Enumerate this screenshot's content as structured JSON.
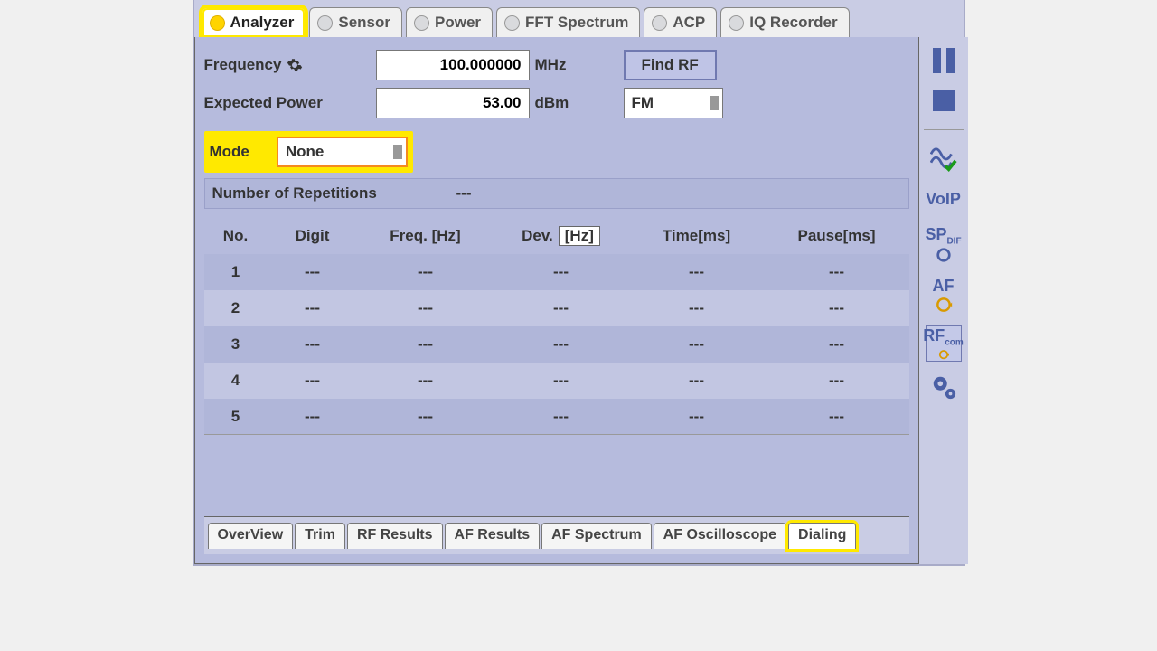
{
  "top_tabs": [
    {
      "label": "Analyzer"
    },
    {
      "label": "Sensor"
    },
    {
      "label": "Power"
    },
    {
      "label": "FFT Spectrum"
    },
    {
      "label": "ACP"
    },
    {
      "label": "IQ Recorder"
    }
  ],
  "params": {
    "freq_label": "Frequency",
    "freq_value": "100.000000",
    "freq_unit": "MHz",
    "findrf": "Find RF",
    "exp_label": "Expected  Power",
    "exp_value": "53.00",
    "exp_unit": "dBm",
    "mod": "FM",
    "mode_label": "Mode",
    "mode_value": "None"
  },
  "rep_label": "Number of Repetitions",
  "rep_value": "---",
  "table": {
    "headers": {
      "no": "No.",
      "digit": "Digit",
      "freq": "Freq. [Hz]",
      "dev_pre": "Dev.",
      "dev_unit": "[Hz]",
      "time": "Time[ms]",
      "pause": "Pause[ms]"
    },
    "rows": [
      {
        "no": "1",
        "digit": "---",
        "freq": "---",
        "dev": "---",
        "time": "---",
        "pause": "---"
      },
      {
        "no": "2",
        "digit": "---",
        "freq": "---",
        "dev": "---",
        "time": "---",
        "pause": "---"
      },
      {
        "no": "3",
        "digit": "---",
        "freq": "---",
        "dev": "---",
        "time": "---",
        "pause": "---"
      },
      {
        "no": "4",
        "digit": "---",
        "freq": "---",
        "dev": "---",
        "time": "---",
        "pause": "---"
      },
      {
        "no": "5",
        "digit": "---",
        "freq": "---",
        "dev": "---",
        "time": "---",
        "pause": "---"
      }
    ]
  },
  "bottom_tabs": [
    {
      "label": "OverView"
    },
    {
      "label": "Trim"
    },
    {
      "label": "RF Results"
    },
    {
      "label": "AF Results"
    },
    {
      "label": "AF Spectrum"
    },
    {
      "label": "AF Oscilloscope"
    },
    {
      "label": "Dialing"
    }
  ],
  "side": {
    "voip": "VoIP",
    "sp": "SP",
    "spdif": "DIF",
    "af": "AF",
    "rf": "RF",
    "rfcom": "com"
  }
}
